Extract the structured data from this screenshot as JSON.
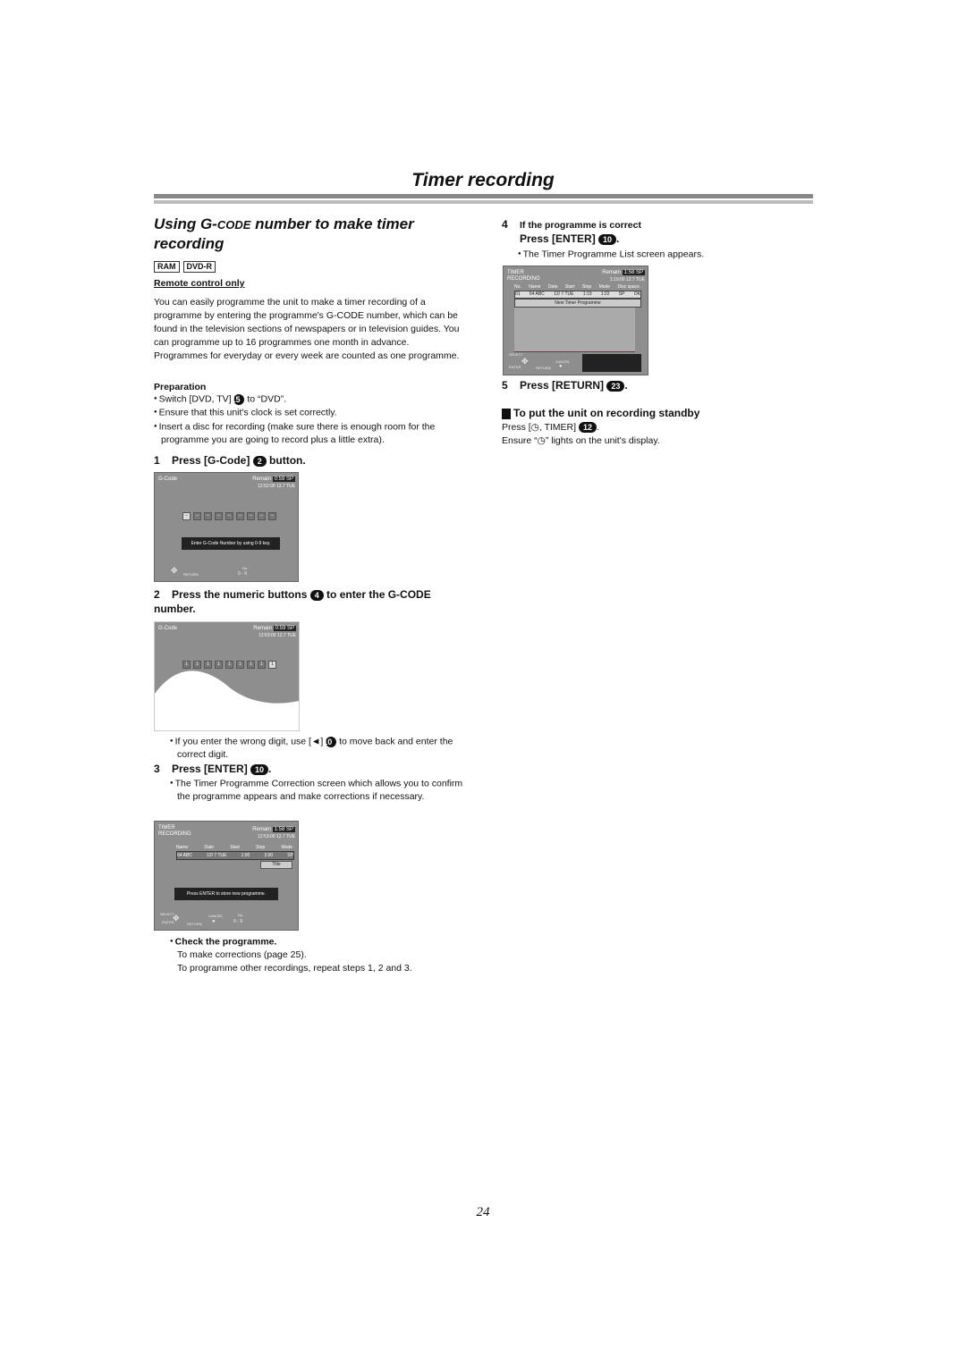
{
  "page": {
    "title": "Timer recording",
    "page_number": "24"
  },
  "section": {
    "heading_pre": "Using G-",
    "heading_sc": "code",
    "heading_post": " number to make timer recording",
    "badges": [
      "RAM",
      "DVD-R"
    ],
    "remote_only": "Remote control only",
    "intro": "You can easily programme the unit to make a timer recording of a programme by entering the programme's G-CODE number, which can be found in the television sections of newspapers or in television guides. You can programme up to 16 programmes one month in advance. Programmes for everyday or every week are counted as one programme."
  },
  "preparation": {
    "title": "Preparation",
    "items": [
      {
        "pre": "Switch [DVD, TV] ",
        "ref": "15",
        "post": " to “DVD”."
      },
      {
        "pre": "Ensure that this unit's clock is set correctly.",
        "ref": "",
        "post": ""
      },
      {
        "pre": "Insert a disc for recording (make sure there is enough room for the programme you are going to record plus a little extra).",
        "ref": "",
        "post": ""
      }
    ]
  },
  "steps": [
    {
      "num": "1",
      "pre": "Press [G-Code] ",
      "ref": "2",
      "post": " button."
    },
    {
      "num": "2",
      "pre": "Press the numeric buttons ",
      "ref": "4",
      "post": " to enter the G-CODE number."
    },
    {
      "num": "3",
      "pre": "Press [ENTER] ",
      "ref": "10",
      "post": "."
    },
    {
      "num": "4",
      "sub": "If the programme is correct",
      "pre": "Press [ENTER] ",
      "ref": "10",
      "post": "."
    },
    {
      "num": "5",
      "pre": "Press [RETURN] ",
      "ref": "23",
      "post": "."
    }
  ],
  "step2_note": {
    "pre": "If you enter the wrong digit, use [◄] ",
    "ref": "10",
    "post": " to move back and enter the correct digit."
  },
  "step3_note": "The Timer Programme Correction screen which allows you to confirm the programme appears and make corrections if necessary.",
  "step3_check": {
    "title": "Check the programme.",
    "line1": "To make corrections (page 25).",
    "line2": "To programme other recordings, repeat steps 1, 2 and 3."
  },
  "step4_note": "The Timer Programme List screen appears.",
  "standby": {
    "title": "To put the unit on recording standby",
    "line1_pre": "Press [◷, TIMER] ",
    "line1_ref": "12",
    "line1_post": ".",
    "line2": "Ensure “◷” lights on the unit's display."
  },
  "screen_gcode1": {
    "title": "G-Code",
    "remain_label": "Remain",
    "remain_value": "0:59 SP",
    "clock": "12:52:00  12.7 TUE",
    "digits": [
      "–",
      "–",
      "–",
      "–",
      "–",
      "–",
      "–",
      "–",
      "–"
    ],
    "message": "Enter G-Code Number by using 0-9 key.",
    "return_label": "RETURN",
    "no_label": "No.",
    "range": "0 - 9"
  },
  "screen_gcode2": {
    "title": "G-Code",
    "remain_label": "Remain",
    "remain_value": "0:59 SP",
    "clock": "12:53:00  12.7 TUE",
    "digits": [
      "1",
      "1",
      "1",
      "1",
      "1",
      "1",
      "1",
      "1",
      "1"
    ]
  },
  "screen_correction": {
    "title_line1": "TIMER",
    "title_line2": "RECORDING",
    "remain_label": "Remain",
    "remain_value": "1:58 SP",
    "clock": "12:53:00  12.7 TUE",
    "headers": [
      "Name",
      "Date",
      "Start",
      "Stop",
      "Mode"
    ],
    "row": [
      "64 ABC",
      "12/ 7 TUE",
      "1:00",
      "2:00",
      "SP"
    ],
    "title_button": "Title",
    "message": "Press ENTER to store new programme.",
    "select_label": "SELECT",
    "enter_label": "ENTER",
    "return_label": "RETURN",
    "cancel_label": "CANCEL",
    "no_label": "No.",
    "range": "0 - 9"
  },
  "screen_list": {
    "title_line1": "TIMER",
    "title_line2": "RECORDING",
    "remain_label": "Remain",
    "remain_value": "1:58 SP",
    "clock": "1:19:00  12.7 TUE",
    "headers": [
      "No.",
      "Name",
      "Date",
      "Start",
      "Stop",
      "Mode",
      "Disc space"
    ],
    "row": [
      "01",
      "64 ABC",
      "12/ 7 TUE",
      "1:19",
      "1:22",
      "SP",
      "OK"
    ],
    "new_label": "New Timer Programme",
    "select_label": "SELECT",
    "enter_label": "ENTER",
    "return_label": "RETURN",
    "cancel_label": "CANCEL"
  }
}
